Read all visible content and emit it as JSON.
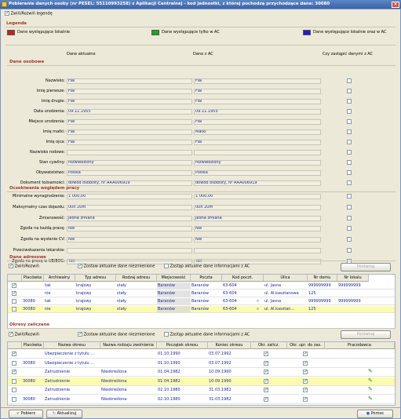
{
  "window": {
    "title": "Pobieranie danych osoby (nr PESEL: 55110993258) z Aplikacji Centralnej - kod jednostki, z której pochodzą przychodzące dane: 30080"
  },
  "toggle_legend": "Zwiń/Rozwiń legendę",
  "legend": {
    "title": "Legenda",
    "items": [
      {
        "label": "Dane występujące lokalnie",
        "color": "#c81e1e"
      },
      {
        "label": "Dane występujące tylko w AC",
        "color": "#1ea81e"
      },
      {
        "label": "Dane występujące lokalnie oraz w AC",
        "color": "#1e1ec8"
      }
    ]
  },
  "columns": {
    "local": "Dane aktualne",
    "ac": "Dane z AC",
    "replace": "Czy zastąpić danymi z AC"
  },
  "personal": {
    "title": "Dane osobowe",
    "rows": [
      {
        "label": "Nazwisko:",
        "local": "Fiai",
        "ac": "Fiai"
      },
      {
        "label": "Imię pierwsze:",
        "local": "Fiai",
        "ac": "Fiai"
      },
      {
        "label": "Imię drugie:",
        "local": "Fiai",
        "ac": "Fiai"
      },
      {
        "label": "Data urodzenia:",
        "local": "09.11.1955",
        "ac": "09.11.1955"
      },
      {
        "label": "Miejsce urodzenia:",
        "local": "Fiai",
        "ac": "Fiai"
      },
      {
        "label": "Imię matki:",
        "local": "Fiai",
        "ac": "Matki"
      },
      {
        "label": "Imię ojca:",
        "local": "Fiai",
        "ac": "Fiai"
      },
      {
        "label": "Nazwisko rodowe:",
        "local": "",
        "ac": ""
      },
      {
        "label": "Stan cywilny:",
        "local": "rozwiedziony",
        "ac": "rozwiedziony"
      },
      {
        "label": "Obywatelstwo:",
        "local": "Polska",
        "ac": "Polska"
      },
      {
        "label": "Dokument tożsamości:",
        "local": "dowód osobisty, nr AAA006919",
        "ac": "dowód osobisty, nr AAA006919"
      }
    ]
  },
  "work": {
    "title": "Oczekiwania względem pracy",
    "rows": [
      {
        "label": "Minimalne wynagrodzenie:",
        "local": "1 000,00",
        "ac": "1 000,00"
      },
      {
        "label": "Maksymalny czas dojazdu:",
        "local": "00h 20m",
        "ac": "00h 20m"
      },
      {
        "label": "Zmianowość:",
        "local": "jedna zmiana",
        "ac": "jedna zmiana"
      },
      {
        "label": "Zgoda na każdą pracę:",
        "local": "Nie",
        "ac": "Nie"
      },
      {
        "label": "Zgoda na wysłanie CV:",
        "local": "Nie",
        "ac": "Nie"
      },
      {
        "label": "Przeciwskazania lekarskie:",
        "local": "",
        "ac": ""
      },
      {
        "label": "Zgoda na pracę w UE/EOG:",
        "local": "Tak",
        "ac": "Tak"
      }
    ]
  },
  "addresses": {
    "title": "Dane adresowe",
    "toggle": "Zwiń/Rozwiń",
    "keep": "Zostaw aktualne dane niezmienione",
    "replace": "Zastąp aktualne dane informacjami z AC",
    "compare": "Porównaj",
    "headers": [
      "Placówka",
      "Archiwalny",
      "Typ adresu",
      "Rodzaj adresu",
      "Miejscowość",
      "Poczta",
      "Kod poczt.",
      "Ulica",
      "Nr domu",
      "Nr lokalu"
    ],
    "rows": [
      {
        "placowka": "",
        "archiwalny": "tak",
        "typ": "krajowy",
        "rodzaj": "stały",
        "miejscowosc": "Baranów",
        "poczta": "Baranów",
        "kod": "63-604",
        "ulica": "ul. Jasna",
        "nr_domu": "999999999",
        "nr_lokalu": "999999999"
      },
      {
        "placowka": "",
        "archiwalny": "nie",
        "typ": "krajowy",
        "rodzaj": "stały",
        "miejscowosc": "Baranów",
        "poczta": "Baranów",
        "kod": "63-604",
        "ulica": "ul. Al.kasztanowa",
        "nr_domu": "125",
        "nr_lokalu": ""
      },
      {
        "placowka": "30080",
        "archiwalny": "tak",
        "typ": "krajowy",
        "rodzaj": "stały",
        "miejscowosc": "Baranów",
        "poczta": "Baranów",
        "kod": "63-604",
        "ulica": "ul. Jasna",
        "nr_domu": "999999999",
        "nr_lokalu": "999999999"
      },
      {
        "placowka": "30080",
        "archiwalny": "nie",
        "typ": "krajowy",
        "rodzaj": "stały",
        "miejscowosc": "Baranów",
        "poczta": "Baranów",
        "kod": "63-604",
        "ulica": "ul. Al.kasztan...",
        "nr_domu": "125",
        "nr_lokalu": ""
      }
    ]
  },
  "periods": {
    "title": "Okresy zaliczane",
    "toggle": "Zwiń/Rozwiń",
    "keep": "Zostaw aktualne dane niezmienione",
    "replace": "Zastąp aktualne dane informacjami z AC",
    "compare": "Porównaj",
    "headers": [
      "Placówka",
      "Nazwa okresu",
      "Nazwa rodzaju zwolnienia",
      "Początek okresu",
      "Koniec okresu",
      "Okr. zalicz.",
      "Okr. upr. do zas.",
      "Pracodawca"
    ],
    "rows": [
      {
        "placowka": "",
        "nazwa": "Ubezpieczenie z tytułu ...",
        "rodzaj": "",
        "poczatek": "01.10.1990",
        "koniec": "03.07.1992"
      },
      {
        "placowka": "30080",
        "nazwa": "Ubezpieczenie z tytułu ...",
        "rodzaj": "",
        "poczatek": "01.10.1990",
        "koniec": "03.07.1992"
      },
      {
        "placowka": "",
        "nazwa": "Zatrudnienie",
        "rodzaj": "Nieokreślona",
        "poczatek": "01.04.1982",
        "koniec": "10.09.1990"
      },
      {
        "placowka": "30080",
        "nazwa": "Zatrudnienie",
        "rodzaj": "Nieokreślona",
        "poczatek": "01.04.1982",
        "koniec": "10.09.1990"
      },
      {
        "placowka": "",
        "nazwa": "Zatrudnienie",
        "rodzaj": "Nieokreślona",
        "poczatek": "02.10.1980",
        "koniec": "31.03.1982"
      },
      {
        "placowka": "30080",
        "nazwa": "Zatrudnienie",
        "rodzaj": "Nieokreślona",
        "poczatek": "02.10.1980",
        "koniec": "31.03.1982"
      }
    ]
  },
  "footer": {
    "fetch": "Pobierz",
    "update": "Aktualizuj",
    "help": "Pomoc"
  }
}
